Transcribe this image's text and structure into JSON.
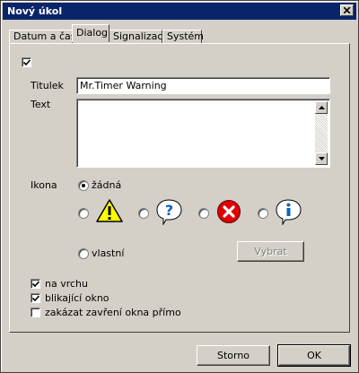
{
  "window": {
    "title": "Nový úkol"
  },
  "tabs": [
    {
      "label": "Datum a čas"
    },
    {
      "label": "Dialog"
    },
    {
      "label": "Signalizace"
    },
    {
      "label": "Systém"
    }
  ],
  "dialog": {
    "enabled_checked": true,
    "title_label": "Titulek",
    "title_value": "Mr.Timer Warning",
    "text_label": "Text",
    "text_value": "",
    "icon_label": "Ikona",
    "icon_options": [
      {
        "name": "none",
        "label": "žádná",
        "selected": true
      },
      {
        "name": "warning-icon",
        "selected": false
      },
      {
        "name": "question-icon",
        "selected": false
      },
      {
        "name": "error-icon",
        "selected": false
      },
      {
        "name": "info-icon",
        "selected": false
      },
      {
        "name": "custom",
        "label": "vlastní",
        "selected": false
      }
    ],
    "choose_button": "Vybrat",
    "options": [
      {
        "label": "na vrchu",
        "checked": true
      },
      {
        "label": "blikající okno",
        "checked": true
      },
      {
        "label": "zakázat zavření okna přímo",
        "checked": false
      }
    ]
  },
  "footer": {
    "cancel": "Storno",
    "ok": "OK"
  },
  "colors": {
    "titlebar": "#0a246a",
    "face": "#d4d0c8",
    "warning": "#ffff00",
    "error": "#e00000",
    "info": "#1060c0"
  }
}
